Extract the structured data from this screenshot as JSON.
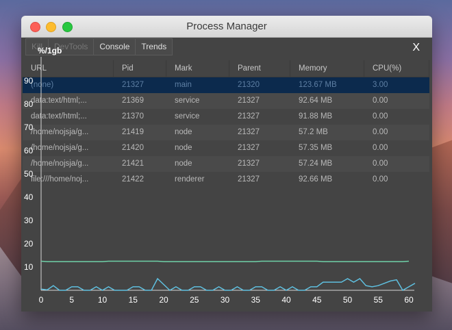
{
  "window": {
    "title": "Process Manager",
    "close_label": "X"
  },
  "toolbar": [
    "Kill",
    "DevTools",
    "Console",
    "Trends"
  ],
  "table": {
    "columns": [
      "URL",
      "Pid",
      "Mark",
      "Parent",
      "Memory",
      "CPU(%)"
    ],
    "rows": [
      [
        "(none)",
        "21327",
        "main",
        "21320",
        "123.67 MB",
        "3.00"
      ],
      [
        "data:text/html;...",
        "21369",
        "service",
        "21327",
        "92.64 MB",
        "0.00"
      ],
      [
        "data:text/html;...",
        "21370",
        "service",
        "21327",
        "91.88 MB",
        "0.00"
      ],
      [
        "/home/nojsja/g...",
        "21419",
        "node",
        "21327",
        "57.2 MB",
        "0.00"
      ],
      [
        "/home/nojsja/g...",
        "21420",
        "node",
        "21327",
        "57.35 MB",
        "0.00"
      ],
      [
        "/home/nojsja/g...",
        "21421",
        "node",
        "21327",
        "57.24 MB",
        "0.00"
      ],
      [
        "file:///home/noj...",
        "21422",
        "renderer",
        "21327",
        "92.66 MB",
        "0.00"
      ]
    ]
  },
  "chart_data": {
    "type": "line",
    "ylabel": "%/1gb",
    "ylim": [
      0,
      90
    ],
    "yticks": [
      10,
      20,
      30,
      40,
      50,
      60,
      70,
      80,
      90
    ],
    "xlim": [
      0,
      60
    ],
    "xticks": [
      0,
      5,
      10,
      15,
      20,
      25,
      30,
      35,
      40,
      45,
      50,
      55,
      60
    ],
    "series": [
      {
        "color": "#6fd1a8",
        "values": [
          12.5,
          12.3,
          12.3,
          12.3,
          12.3,
          12.3,
          12.3,
          12.3,
          12.3,
          12.3,
          12.3,
          12.5,
          12.5,
          12.5,
          12.5,
          12.5,
          12.5,
          12.5,
          12.5,
          12.5,
          12.3,
          12.3,
          12.3,
          12.3,
          12.3,
          12.3,
          12.3,
          12.3,
          12.3,
          12.3,
          12.3,
          12.3,
          12.3,
          12.3,
          12.3,
          12.3,
          12.5,
          12.5,
          12.5,
          12.5,
          12.5,
          12.5,
          12.5,
          12.5,
          12.5,
          12.5,
          12.3,
          12.3,
          12.3,
          12.3,
          12.3,
          12.3,
          12.3,
          12.3,
          12.3,
          12.3,
          12.3,
          12.3,
          12.3,
          12.3,
          12.5
        ]
      },
      {
        "color": "#5fc0e0",
        "values": [
          0.5,
          0.2,
          2,
          0,
          0,
          1.5,
          1.5,
          0,
          0,
          1.5,
          0,
          1.5,
          0,
          0,
          0,
          1.5,
          1.5,
          0,
          0,
          5,
          2.5,
          0,
          1.5,
          0,
          0,
          1.5,
          1.5,
          0,
          0,
          1.5,
          0,
          0,
          1.5,
          0,
          0,
          1.5,
          1.5,
          0,
          0,
          1.5,
          0,
          1.5,
          0,
          0,
          1.5,
          1.5,
          3.5,
          3.5,
          3.5,
          3.5,
          5,
          3.5,
          5,
          2,
          1.5,
          2,
          3,
          4,
          4.5,
          0,
          1.5,
          3
        ]
      }
    ]
  }
}
